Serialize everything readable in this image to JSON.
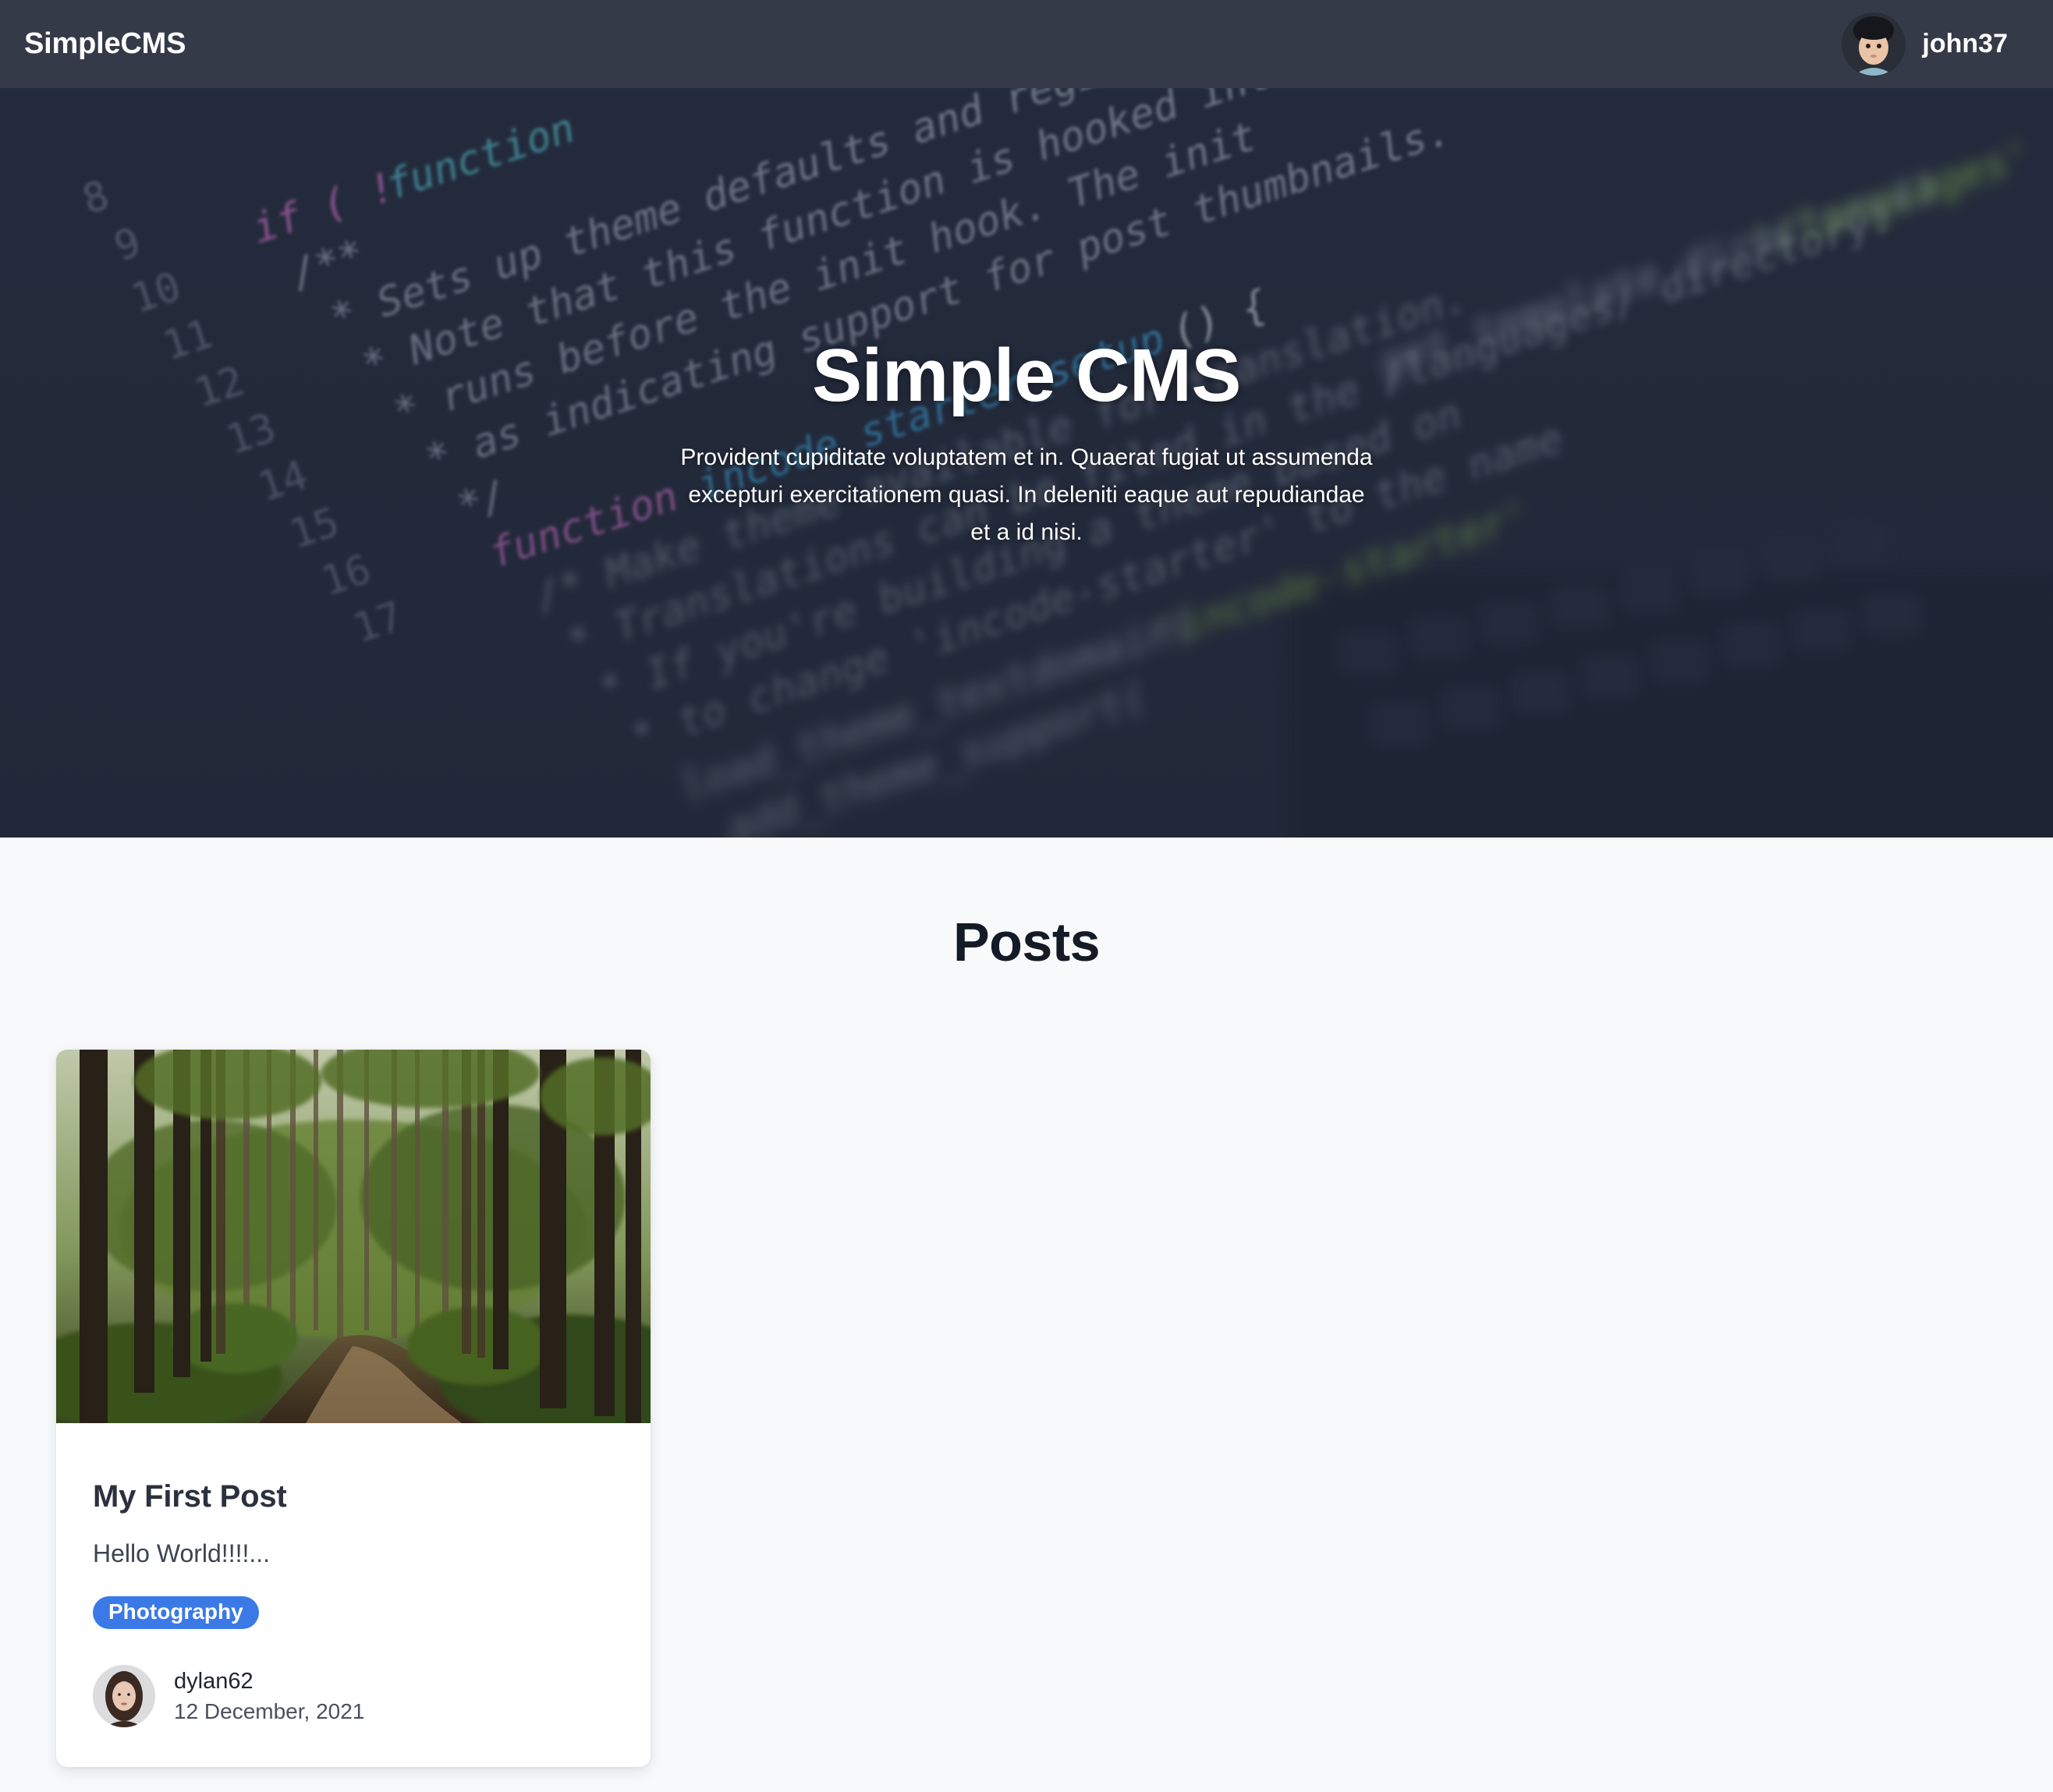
{
  "navbar": {
    "brand": "SimpleCMS",
    "username": "john37",
    "user_avatar_icon": "avatar-photo"
  },
  "hero": {
    "title": "Simple CMS",
    "subtitle": "Provident cupiditate voluptatem et in. Quaerat fugiat ut assumenda excepturi exercitationem quasi. In deleniti eaque aut repudiandae et a id nisi."
  },
  "posts": {
    "heading": "Posts",
    "items": [
      {
        "title": "My First Post",
        "excerpt": "Hello World!!!!...",
        "tag": "Photography",
        "author": "dylan62",
        "date": "12 December, 2021"
      }
    ]
  },
  "colors": {
    "navbar": "#343a48",
    "tag": "#3b7ae6",
    "background": "#f8f9fb"
  }
}
